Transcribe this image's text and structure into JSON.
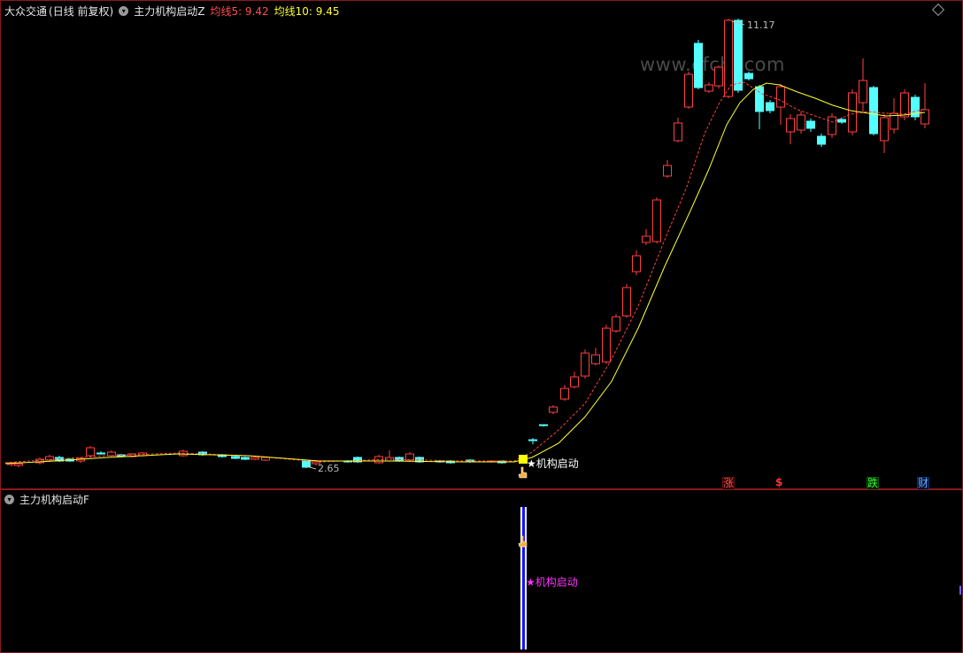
{
  "main_panel": {
    "stock_name": "大众交通",
    "period_label": "(日线 前复权)",
    "indicator_name": "主力机构启动Z",
    "ma5_label": "均线5: 9.42",
    "ma10_label": "均线10: 9.45",
    "high_label": "11.17",
    "low_label": "2.65",
    "signal_label": "★机构启动",
    "watermark": "www.cfchi.com",
    "badges": [
      "涨",
      "$",
      "跌",
      "财"
    ]
  },
  "sub_panel": {
    "indicator_name": "主力机构启动F",
    "signal_label": "★机构启动"
  },
  "colors": {
    "up": "#ff4040",
    "down": "#54ffff",
    "ma5": "#ff4040",
    "ma10": "#ffff33",
    "signal_bar": "#1414ff",
    "signal_text_main": "#ffffff",
    "signal_text_sub": "#ff33ff"
  },
  "icons": {
    "menu": "circle-chevron-icon",
    "top_right": "diamond-icon",
    "signal_marker": "yellow-square-icon",
    "pointer": "hand-cursor-icon"
  }
}
